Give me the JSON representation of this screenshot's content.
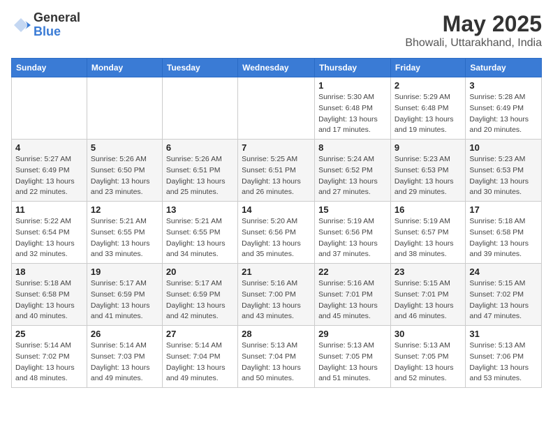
{
  "logo": {
    "general": "General",
    "blue": "Blue"
  },
  "title": {
    "month": "May 2025",
    "location": "Bhowali, Uttarakhand, India"
  },
  "days_of_week": [
    "Sunday",
    "Monday",
    "Tuesday",
    "Wednesday",
    "Thursday",
    "Friday",
    "Saturday"
  ],
  "weeks": [
    [
      {
        "day": "",
        "sunrise": "",
        "sunset": "",
        "daylight": ""
      },
      {
        "day": "",
        "sunrise": "",
        "sunset": "",
        "daylight": ""
      },
      {
        "day": "",
        "sunrise": "",
        "sunset": "",
        "daylight": ""
      },
      {
        "day": "",
        "sunrise": "",
        "sunset": "",
        "daylight": ""
      },
      {
        "day": "1",
        "sunrise": "5:30 AM",
        "sunset": "6:48 PM",
        "daylight": "13 hours and 17 minutes."
      },
      {
        "day": "2",
        "sunrise": "5:29 AM",
        "sunset": "6:48 PM",
        "daylight": "13 hours and 19 minutes."
      },
      {
        "day": "3",
        "sunrise": "5:28 AM",
        "sunset": "6:49 PM",
        "daylight": "13 hours and 20 minutes."
      }
    ],
    [
      {
        "day": "4",
        "sunrise": "5:27 AM",
        "sunset": "6:49 PM",
        "daylight": "13 hours and 22 minutes."
      },
      {
        "day": "5",
        "sunrise": "5:26 AM",
        "sunset": "6:50 PM",
        "daylight": "13 hours and 23 minutes."
      },
      {
        "day": "6",
        "sunrise": "5:26 AM",
        "sunset": "6:51 PM",
        "daylight": "13 hours and 25 minutes."
      },
      {
        "day": "7",
        "sunrise": "5:25 AM",
        "sunset": "6:51 PM",
        "daylight": "13 hours and 26 minutes."
      },
      {
        "day": "8",
        "sunrise": "5:24 AM",
        "sunset": "6:52 PM",
        "daylight": "13 hours and 27 minutes."
      },
      {
        "day": "9",
        "sunrise": "5:23 AM",
        "sunset": "6:53 PM",
        "daylight": "13 hours and 29 minutes."
      },
      {
        "day": "10",
        "sunrise": "5:23 AM",
        "sunset": "6:53 PM",
        "daylight": "13 hours and 30 minutes."
      }
    ],
    [
      {
        "day": "11",
        "sunrise": "5:22 AM",
        "sunset": "6:54 PM",
        "daylight": "13 hours and 32 minutes."
      },
      {
        "day": "12",
        "sunrise": "5:21 AM",
        "sunset": "6:55 PM",
        "daylight": "13 hours and 33 minutes."
      },
      {
        "day": "13",
        "sunrise": "5:21 AM",
        "sunset": "6:55 PM",
        "daylight": "13 hours and 34 minutes."
      },
      {
        "day": "14",
        "sunrise": "5:20 AM",
        "sunset": "6:56 PM",
        "daylight": "13 hours and 35 minutes."
      },
      {
        "day": "15",
        "sunrise": "5:19 AM",
        "sunset": "6:56 PM",
        "daylight": "13 hours and 37 minutes."
      },
      {
        "day": "16",
        "sunrise": "5:19 AM",
        "sunset": "6:57 PM",
        "daylight": "13 hours and 38 minutes."
      },
      {
        "day": "17",
        "sunrise": "5:18 AM",
        "sunset": "6:58 PM",
        "daylight": "13 hours and 39 minutes."
      }
    ],
    [
      {
        "day": "18",
        "sunrise": "5:18 AM",
        "sunset": "6:58 PM",
        "daylight": "13 hours and 40 minutes."
      },
      {
        "day": "19",
        "sunrise": "5:17 AM",
        "sunset": "6:59 PM",
        "daylight": "13 hours and 41 minutes."
      },
      {
        "day": "20",
        "sunrise": "5:17 AM",
        "sunset": "6:59 PM",
        "daylight": "13 hours and 42 minutes."
      },
      {
        "day": "21",
        "sunrise": "5:16 AM",
        "sunset": "7:00 PM",
        "daylight": "13 hours and 43 minutes."
      },
      {
        "day": "22",
        "sunrise": "5:16 AM",
        "sunset": "7:01 PM",
        "daylight": "13 hours and 45 minutes."
      },
      {
        "day": "23",
        "sunrise": "5:15 AM",
        "sunset": "7:01 PM",
        "daylight": "13 hours and 46 minutes."
      },
      {
        "day": "24",
        "sunrise": "5:15 AM",
        "sunset": "7:02 PM",
        "daylight": "13 hours and 47 minutes."
      }
    ],
    [
      {
        "day": "25",
        "sunrise": "5:14 AM",
        "sunset": "7:02 PM",
        "daylight": "13 hours and 48 minutes."
      },
      {
        "day": "26",
        "sunrise": "5:14 AM",
        "sunset": "7:03 PM",
        "daylight": "13 hours and 49 minutes."
      },
      {
        "day": "27",
        "sunrise": "5:14 AM",
        "sunset": "7:04 PM",
        "daylight": "13 hours and 49 minutes."
      },
      {
        "day": "28",
        "sunrise": "5:13 AM",
        "sunset": "7:04 PM",
        "daylight": "13 hours and 50 minutes."
      },
      {
        "day": "29",
        "sunrise": "5:13 AM",
        "sunset": "7:05 PM",
        "daylight": "13 hours and 51 minutes."
      },
      {
        "day": "30",
        "sunrise": "5:13 AM",
        "sunset": "7:05 PM",
        "daylight": "13 hours and 52 minutes."
      },
      {
        "day": "31",
        "sunrise": "5:13 AM",
        "sunset": "7:06 PM",
        "daylight": "13 hours and 53 minutes."
      }
    ]
  ]
}
